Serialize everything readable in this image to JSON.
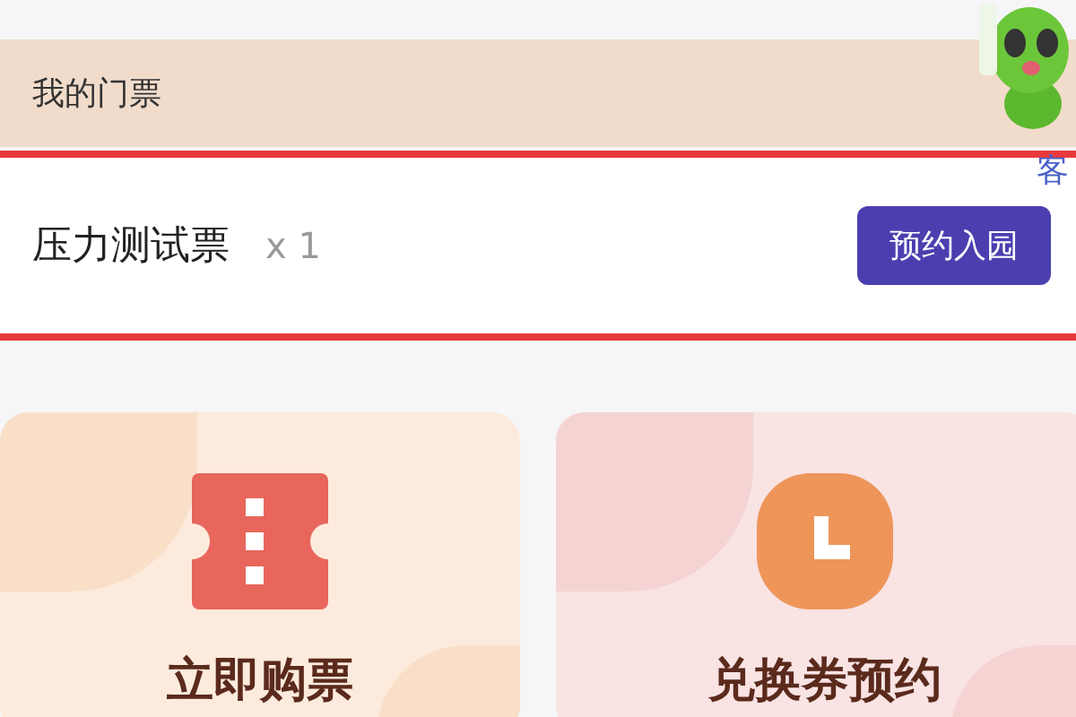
{
  "header": {
    "title": "我的门票",
    "service_label": "客"
  },
  "ticket": {
    "name": "压力测试票",
    "quantity": "x 1",
    "button": "预约入园"
  },
  "actions": [
    {
      "label": "立即购票",
      "kind": "ticket"
    },
    {
      "label": "兑换券预约",
      "kind": "clock"
    }
  ]
}
